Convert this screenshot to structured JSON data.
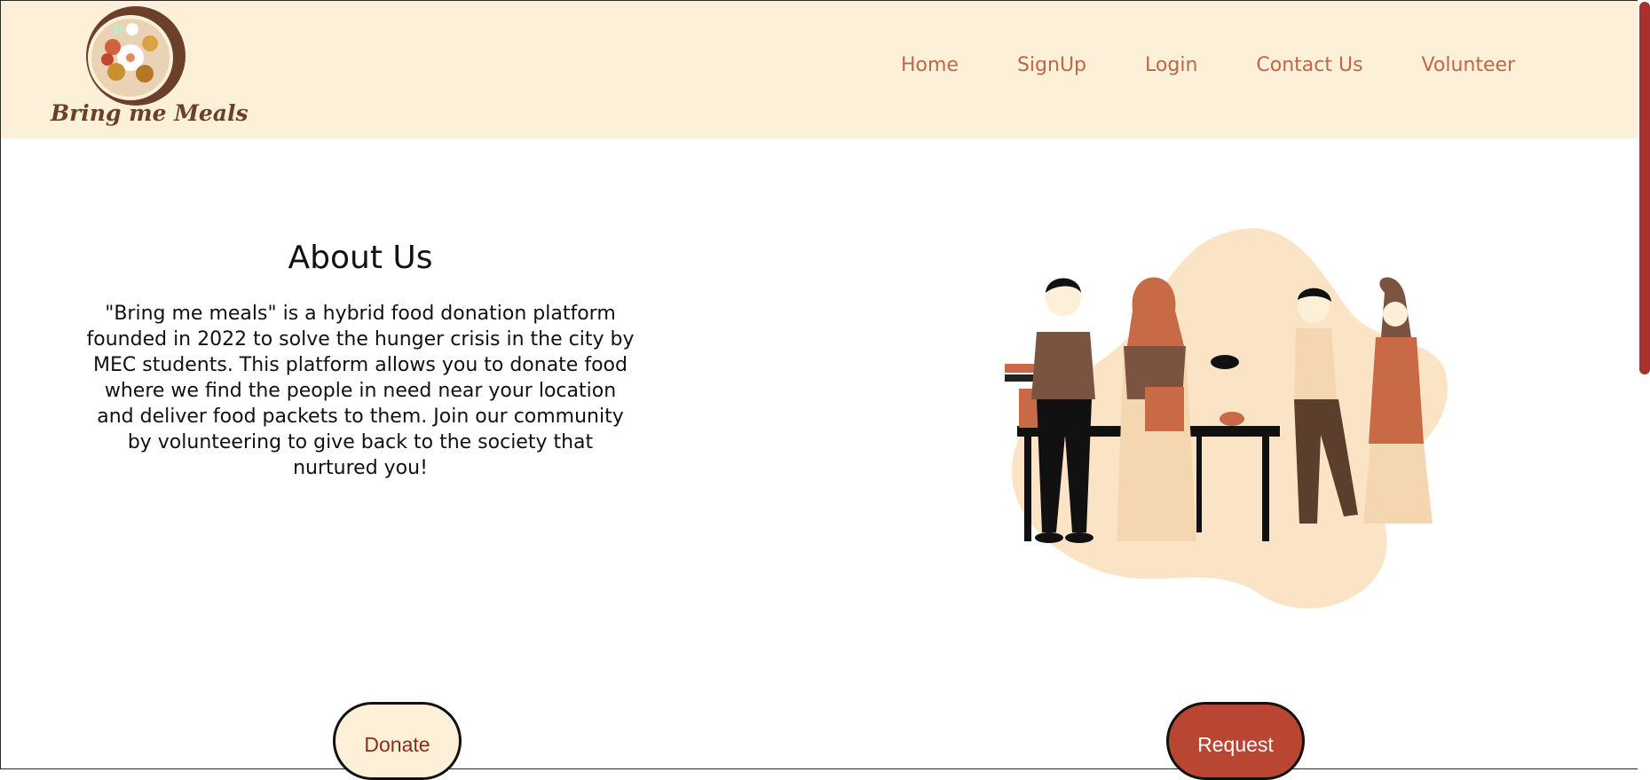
{
  "brand": {
    "name": "Bring me Meals",
    "logo_icon": "food-plate-icon"
  },
  "nav": {
    "items": [
      {
        "label": "Home"
      },
      {
        "label": "SignUp"
      },
      {
        "label": "Login"
      },
      {
        "label": "Contact Us"
      },
      {
        "label": "Volunteer"
      }
    ]
  },
  "about": {
    "title": "About Us",
    "body": "\"Bring me meals\" is a hybrid food donation platform founded in 2022 to solve the hunger crisis in the city by MEC students. This platform allows you to donate food where we find the people in need near your location and deliver food packets to them. Join our community by volunteering to give back to the society that nurtured you!"
  },
  "illustration": {
    "icon": "food-donation-illustration"
  },
  "actions": {
    "donate_label": "Donate",
    "request_label": "Request"
  },
  "colors": {
    "header_bg": "#fdf0d8",
    "accent": "#c0664a",
    "brand_brown": "#6b3f2a",
    "request_bg": "#b94533",
    "scrollbar": "#a8302d"
  }
}
